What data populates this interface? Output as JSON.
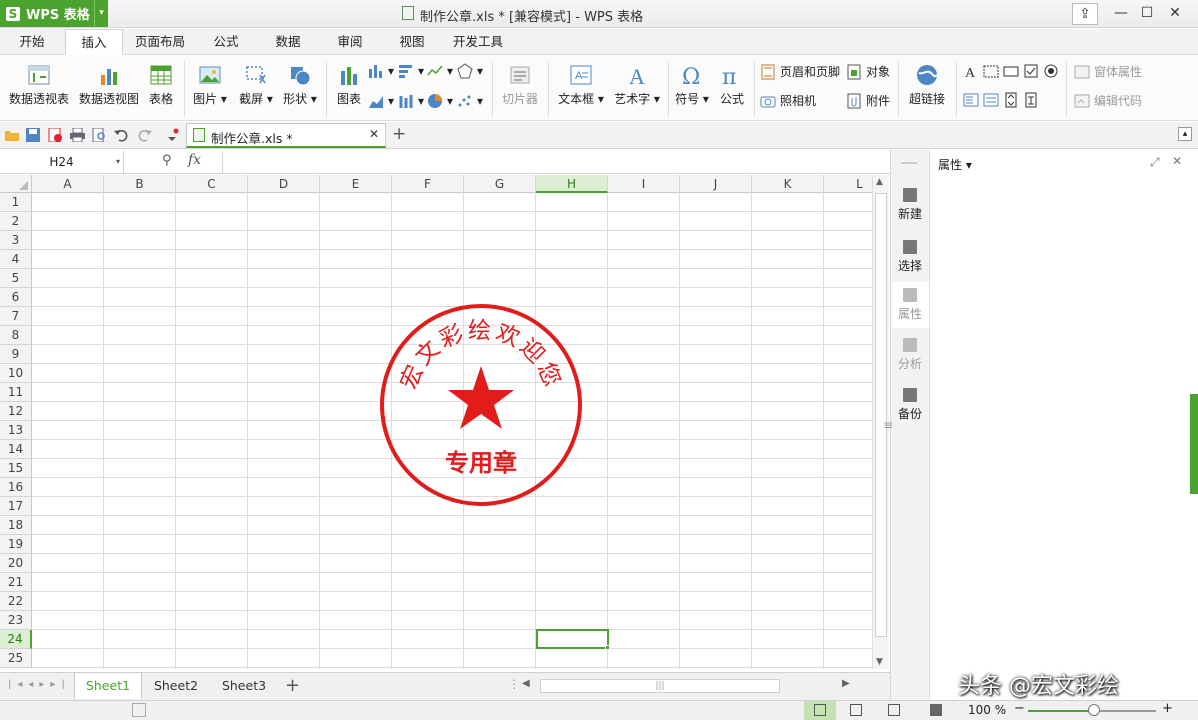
{
  "app": {
    "name": "WPS 表格",
    "title": "制作公章.xls * [兼容模式] - WPS 表格"
  },
  "menu_tabs": [
    "开始",
    "插入",
    "页面布局",
    "公式",
    "数据",
    "审阅",
    "视图",
    "开发工具"
  ],
  "active_tab": "插入",
  "ribbon": {
    "pivot_table": "数据透视表",
    "pivot_chart": "数据透视图",
    "table": "表格",
    "picture": "图片",
    "screenshot": "截屏",
    "shape": "形状",
    "chart": "图表",
    "slicer": "切片器",
    "textbox": "文本框",
    "wordart": "艺术字",
    "symbol": "符号",
    "formula": "公式",
    "header_footer": "页眉和页脚",
    "object": "对象",
    "camera": "照相机",
    "attachment": "附件",
    "hyperlink": "超链接",
    "form_props": "窗体属性",
    "edit_code": "编辑代码"
  },
  "document_tab": {
    "label": "制作公章.xls *"
  },
  "formula_bar": {
    "name_box": "H24",
    "fx": "fx",
    "value": ""
  },
  "grid": {
    "columns": [
      "A",
      "B",
      "C",
      "D",
      "E",
      "F",
      "G",
      "H",
      "I",
      "J",
      "K",
      "L"
    ],
    "rows": [
      "1",
      "2",
      "3",
      "4",
      "5",
      "6",
      "7",
      "8",
      "9",
      "10",
      "11",
      "12",
      "13",
      "14",
      "15",
      "16",
      "17",
      "18",
      "19",
      "20",
      "21",
      "22",
      "23",
      "24",
      "25"
    ],
    "selected_cell": "H24"
  },
  "seal": {
    "arc_text": "宏文彩绘欢迎您",
    "bottom_text": "专用章",
    "color": "#e21b1b"
  },
  "sheets": [
    "Sheet1",
    "Sheet2",
    "Sheet3"
  ],
  "active_sheet": "Sheet1",
  "side_strip": [
    "新建",
    "选择",
    "属性",
    "分析",
    "备份"
  ],
  "panel": {
    "title": "属性"
  },
  "status": {
    "zoom": "100 %"
  },
  "watermark": "头条 @宏文彩绘",
  "colors": {
    "brand_green": "#4ca22e",
    "seal_red": "#e21b1b"
  }
}
